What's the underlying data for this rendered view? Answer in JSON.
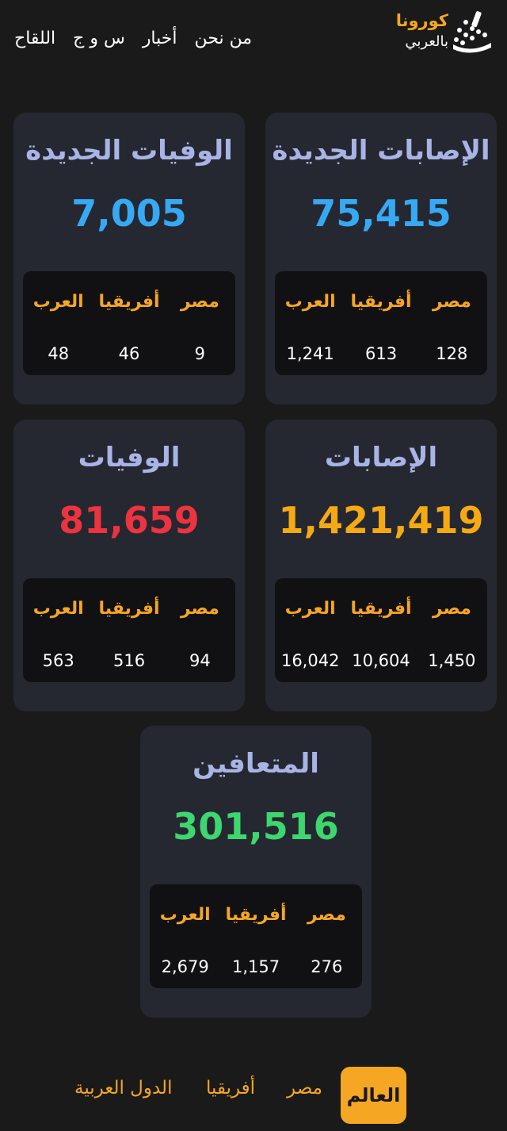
{
  "nav": {
    "links": [
      "اللقاح",
      "س و ج",
      "أخبار",
      "من نحن"
    ]
  },
  "logo": {
    "line1": "كورونا",
    "line2": "بالعربي"
  },
  "colors": {
    "accent": "#f5a623",
    "cases": "#36a9f5",
    "deaths": "#ee3340",
    "total_cases": "#f5aa14",
    "recovered": "#3dd66f",
    "title": "#a9b4e6"
  },
  "cards": {
    "new_cases": {
      "title": "الإصابات الجديدة",
      "value": "75,415",
      "labels": [
        "مصر",
        "أفريقيا",
        "العرب"
      ],
      "values": [
        "128",
        "613",
        "1,241"
      ]
    },
    "new_deaths": {
      "title": "الوفيات الجديدة",
      "value": "7,005",
      "labels": [
        "مصر",
        "أفريقيا",
        "العرب"
      ],
      "values": [
        "9",
        "46",
        "48"
      ]
    },
    "cases": {
      "title": "الإصابات",
      "value": "1,421,419",
      "labels": [
        "مصر",
        "أفريقيا",
        "العرب"
      ],
      "values": [
        "1,450",
        "10,604",
        "16,042"
      ]
    },
    "deaths": {
      "title": "الوفيات",
      "value": "81,659",
      "labels": [
        "مصر",
        "أفريقيا",
        "العرب"
      ],
      "values": [
        "94",
        "516",
        "563"
      ]
    },
    "recovered": {
      "title": "المتعافين",
      "value": "301,516",
      "labels": [
        "مصر",
        "أفريقيا",
        "العرب"
      ],
      "values": [
        "276",
        "1,157",
        "2,679"
      ]
    }
  },
  "tabs": {
    "world": "العالم",
    "egypt": "مصر",
    "africa": "أفريقيا",
    "arab": "الدول العربية"
  }
}
